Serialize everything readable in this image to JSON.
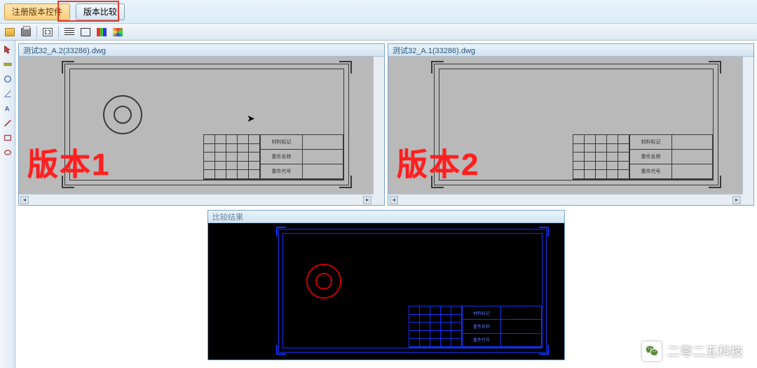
{
  "topbar": {
    "register_label": "注册版本控件",
    "compare_label": "版本比较"
  },
  "panels": {
    "left_title": "测试32_A.2(33286).dwg",
    "right_title": "测试32_A.1(33286).dwg",
    "left_overlay": "版本1",
    "right_overlay": "版本2"
  },
  "title_block": {
    "labels": [
      "材料标记",
      "重件名称",
      "重件代号"
    ]
  },
  "bottom": {
    "title": "比较结果",
    "labels": [
      "材料标记",
      "重件名称",
      "重件代号"
    ]
  },
  "watermark": {
    "text": "二零二五科技"
  }
}
